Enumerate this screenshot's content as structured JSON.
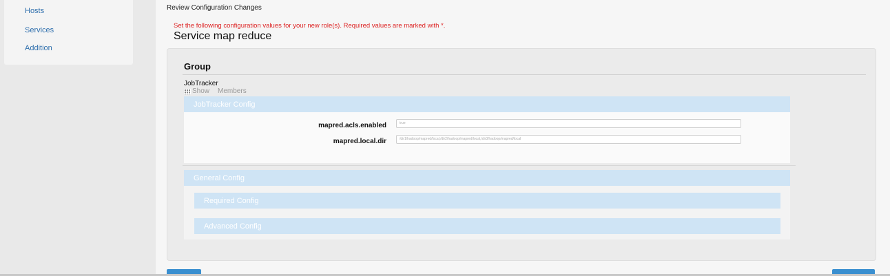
{
  "sidebar": {
    "items": [
      {
        "label": "Hosts"
      },
      {
        "label": "Services"
      },
      {
        "label": "Addition"
      }
    ]
  },
  "main": {
    "review_title": "Review Configuration Changes",
    "warning": "Set the following configuration values for your new role(s). Required values are marked with *.",
    "service_title": "Service map reduce"
  },
  "group": {
    "title": "Group",
    "role": "JobTracker",
    "show_label": "Show",
    "members_label": "Members"
  },
  "sections": {
    "jobtracker": {
      "title": "JobTracker Config",
      "fields": [
        {
          "label": "mapred.acls.enabled",
          "value": "true"
        },
        {
          "label": "mapred.local.dir",
          "value": "/dir1/hadoop/mapred/local,/dir2/hadoop/mapred/local,/dir3/hadoop/mapred/local"
        }
      ]
    },
    "general": {
      "title": "General Config"
    },
    "required": {
      "title": "Required Config"
    },
    "advanced": {
      "title": "Advanced Config"
    }
  },
  "colors": {
    "section_header": "#cfe4f5",
    "warning": "#dd2222",
    "link": "#2f6fad",
    "button": "#3a8fd0"
  }
}
